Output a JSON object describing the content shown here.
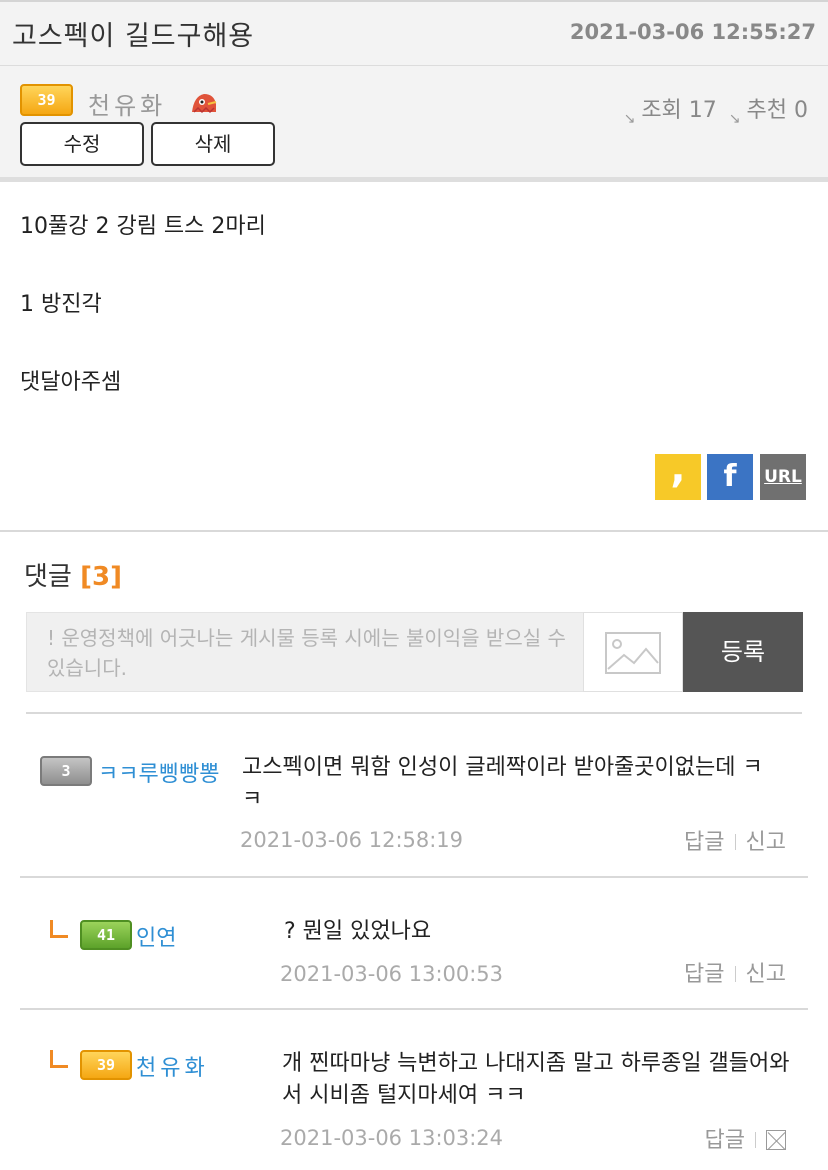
{
  "post": {
    "title": "고스펙이 길드구해용",
    "date": "2021-03-06 12:55:27",
    "author": {
      "level": "39",
      "name": "천유화"
    },
    "stats": {
      "views_label": "조회 17",
      "recommend_label": "추천 0"
    },
    "buttons": {
      "edit": "수정",
      "delete": "삭제"
    },
    "body": [
      "10풀강 2 강림 트스 2마리",
      "1 방진각",
      "댓달아주셈"
    ],
    "share": {
      "kakao_glyph": ",",
      "facebook_glyph": "f",
      "url_label": "URL"
    }
  },
  "comments": {
    "heading": "댓글",
    "count": "[3]",
    "form": {
      "placeholder": "! 운영정책에 어긋나는 게시물 등록 시에는 불이익을 받으실 수 있습니다.",
      "submit": "등록"
    },
    "items": [
      {
        "level": "3",
        "nick": "ㅋㅋ루삥빵뽕",
        "text": "고스펙이면 뭐함 인성이 글레짝이라 받아줄곳이없는데 ㅋㅋ",
        "date": "2021-03-06 12:58:19",
        "reply": "답글",
        "report": "신고"
      },
      {
        "level": "41",
        "nick": "인연",
        "text": "? 뭔일 있었나요",
        "date": "2021-03-06 13:00:53",
        "reply": "답글",
        "report": "신고"
      },
      {
        "level": "39",
        "nick": "천유화",
        "text": "개 찐따마냥 늑변하고 나대지좀 말고 하루종일 갤들어와서 시비좀 털지마세여 ㅋㅋ",
        "date": "2021-03-06 13:03:24",
        "reply": "답글"
      }
    ]
  },
  "colors": {
    "accent": "#f08a24",
    "nick": "#2f8fd4",
    "submit_bg": "#555555"
  }
}
